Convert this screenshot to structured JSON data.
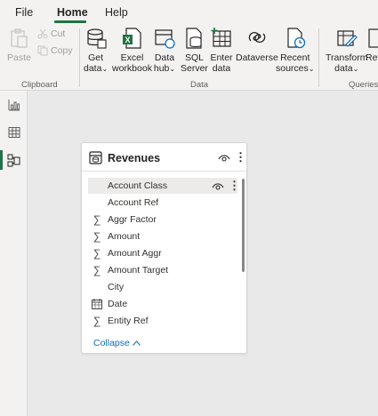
{
  "menubar": {
    "tabs": [
      {
        "label": "File"
      },
      {
        "label": "Home"
      },
      {
        "label": "Help"
      }
    ]
  },
  "ribbon": {
    "clipboard": {
      "paste": "Paste",
      "cut": "Cut",
      "copy": "Copy",
      "group_label": "Clipboard"
    },
    "data": {
      "get_data": [
        "Get",
        "data"
      ],
      "excel": [
        "Excel",
        "workbook"
      ],
      "data_hub": [
        "Data",
        "hub"
      ],
      "sql": [
        "SQL",
        "Server"
      ],
      "enter": [
        "Enter",
        "data"
      ],
      "dataverse": [
        "Dataverse"
      ],
      "recent": [
        "Recent",
        "sources"
      ],
      "group_label": "Data"
    },
    "queries": {
      "transform": [
        "Transform",
        "data"
      ],
      "refresh_partial": "Ref",
      "group_label": "Queries"
    }
  },
  "card": {
    "title": "Revenues",
    "fields": [
      {
        "label": "Account Class",
        "icon": "none"
      },
      {
        "label": "Account Ref",
        "icon": "none"
      },
      {
        "label": "Aggr Factor",
        "icon": "sigma"
      },
      {
        "label": "Amount",
        "icon": "sigma"
      },
      {
        "label": "Amount Aggr",
        "icon": "sigma"
      },
      {
        "label": "Amount Target",
        "icon": "sigma"
      },
      {
        "label": "City",
        "icon": "none"
      },
      {
        "label": "Date",
        "icon": "calendar"
      },
      {
        "label": "Entity Ref",
        "icon": "sigma"
      }
    ],
    "collapse_label": "Collapse"
  },
  "colors": {
    "accent": "#217346",
    "link": "#0f6cbd"
  }
}
